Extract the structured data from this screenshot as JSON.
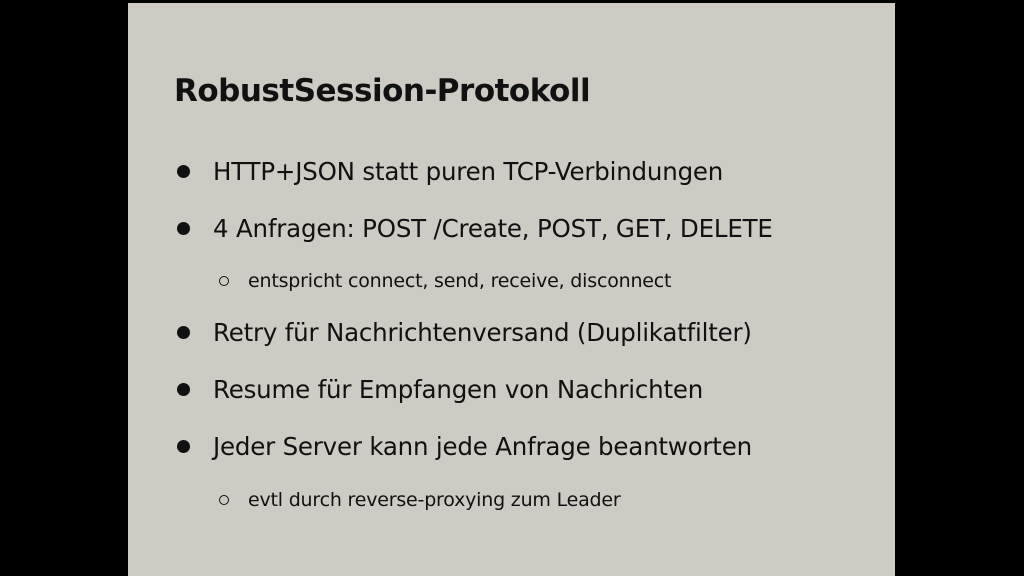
{
  "slide": {
    "title": "RobustSession-Protokoll",
    "bullets": [
      {
        "text": "HTTP+JSON statt puren TCP-Verbindungen"
      },
      {
        "text": "4 Anfragen: POST /Create, POST, GET, DELETE"
      },
      {
        "text": "entspricht connect, send, receive, disconnect"
      },
      {
        "text": "Retry für Nachrichtenversand (Duplikatfilter)"
      },
      {
        "text": "Resume für Empfangen von Nachrichten"
      },
      {
        "text": "Jeder Server kann jede Anfrage beantworten"
      },
      {
        "text": "evtl durch reverse-proxying zum Leader"
      }
    ]
  },
  "colors": {
    "background": "#000000",
    "slide": "#cdcbc3",
    "text": "#111111"
  }
}
